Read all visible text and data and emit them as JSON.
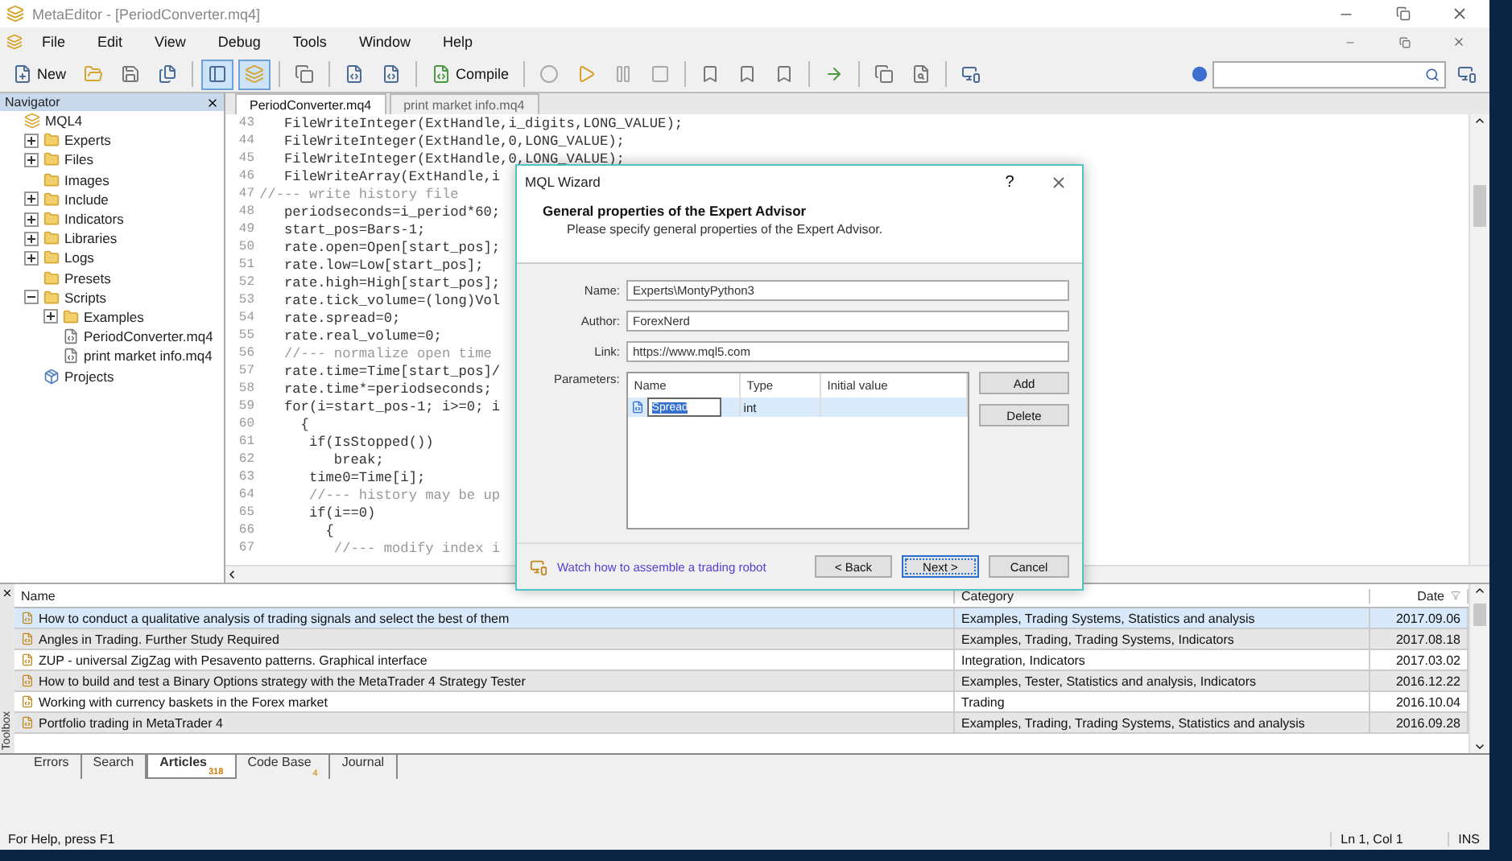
{
  "window": {
    "title": "MetaEditor - [PeriodConverter.mq4]"
  },
  "menu": [
    "File",
    "Edit",
    "View",
    "Debug",
    "Tools",
    "Window",
    "Help"
  ],
  "toolbar": {
    "new_label": "New",
    "compile_label": "Compile",
    "toggles": [
      {
        "selected": true
      },
      {
        "selected": true
      }
    ]
  },
  "navigator": {
    "title": "Navigator",
    "tree": [
      {
        "label": "MQL4",
        "kind": "root",
        "children": [
          {
            "label": "Experts",
            "kind": "folder",
            "expanded": false
          },
          {
            "label": "Files",
            "kind": "folder",
            "expanded": false
          },
          {
            "label": "Images",
            "kind": "folder"
          },
          {
            "label": "Include",
            "kind": "folder",
            "expanded": false
          },
          {
            "label": "Indicators",
            "kind": "folder",
            "expanded": false
          },
          {
            "label": "Libraries",
            "kind": "folder",
            "expanded": false
          },
          {
            "label": "Logs",
            "kind": "folder",
            "expanded": false
          },
          {
            "label": "Presets",
            "kind": "folder"
          },
          {
            "label": "Scripts",
            "kind": "folder",
            "expanded": true,
            "children": [
              {
                "label": "Examples",
                "kind": "folder",
                "expanded": false
              },
              {
                "label": "PeriodConverter.mq4",
                "kind": "file"
              },
              {
                "label": "print market info.mq4",
                "kind": "file"
              }
            ]
          },
          {
            "label": "Projects",
            "kind": "project"
          }
        ]
      }
    ]
  },
  "editor": {
    "tabs": [
      {
        "label": "PeriodConverter.mq4",
        "selected": true
      },
      {
        "label": "print market info.mq4",
        "selected": false
      }
    ],
    "lines": [
      {
        "number": "43",
        "text": "   FileWriteInteger(ExtHandle,i_digits,LONG_VALUE);",
        "kind": "code"
      },
      {
        "number": "44",
        "text": "   FileWriteInteger(ExtHandle,0,LONG_VALUE);",
        "kind": "code"
      },
      {
        "number": "45",
        "text": "   FileWriteInteger(ExtHandle,0,LONG_VALUE);",
        "kind": "code"
      },
      {
        "number": "46",
        "text": "   FileWriteArray(ExtHandle,i",
        "kind": "code"
      },
      {
        "number": "47",
        "text": "//--- write history file",
        "kind": "comment"
      },
      {
        "number": "48",
        "text": "   periodseconds=i_period*60;",
        "kind": "code"
      },
      {
        "number": "49",
        "text": "   start_pos=Bars-1;",
        "kind": "code"
      },
      {
        "number": "50",
        "text": "   rate.open=Open[start_pos];",
        "kind": "code"
      },
      {
        "number": "51",
        "text": "   rate.low=Low[start_pos];",
        "kind": "code"
      },
      {
        "number": "52",
        "text": "   rate.high=High[start_pos];",
        "kind": "code"
      },
      {
        "number": "53",
        "text": "   rate.tick_volume=(long)Vol",
        "kind": "code"
      },
      {
        "number": "54",
        "text": "   rate.spread=0;",
        "kind": "code"
      },
      {
        "number": "55",
        "text": "   rate.real_volume=0;",
        "kind": "code"
      },
      {
        "number": "56",
        "text": "   //--- normalize open time",
        "kind": "comment"
      },
      {
        "number": "57",
        "text": "   rate.time=Time[start_pos]/",
        "kind": "code"
      },
      {
        "number": "58",
        "text": "   rate.time*=periodseconds;",
        "kind": "code"
      },
      {
        "number": "59",
        "text": "   for(i=start_pos-1; i>=0; i",
        "kind": "code"
      },
      {
        "number": "60",
        "text": "     {",
        "kind": "code"
      },
      {
        "number": "61",
        "text": "      if(IsStopped())",
        "kind": "code"
      },
      {
        "number": "62",
        "text": "         break;",
        "kind": "code"
      },
      {
        "number": "63",
        "text": "      time0=Time[i];",
        "kind": "code"
      },
      {
        "number": "64",
        "text": "      //--- history may be up",
        "kind": "comment"
      },
      {
        "number": "65",
        "text": "      if(i==0)",
        "kind": "code"
      },
      {
        "number": "66",
        "text": "        {",
        "kind": "code"
      },
      {
        "number": "67",
        "text": "         //--- modify index i",
        "kind": "comment"
      }
    ]
  },
  "dialog": {
    "title": "MQL Wizard",
    "help": "?",
    "heading": "General properties of the Expert Advisor",
    "subheading": "Please specify general properties of the Expert Advisor.",
    "fields": [
      {
        "label": "Name:",
        "value": "Experts\\MontyPython3"
      },
      {
        "label": "Author:",
        "value": "ForexNerd"
      },
      {
        "label": "Link:",
        "value": "https://www.mql5.com"
      }
    ],
    "parameters": {
      "label": "Parameters:",
      "columns": [
        "Name",
        "Type",
        "Initial value"
      ],
      "rows": [
        {
          "name": "Spread",
          "type": "int",
          "selected": true
        }
      ],
      "buttons": [
        "Add",
        "Delete"
      ]
    },
    "link": "Watch how to assemble a trading robot",
    "buttons": [
      {
        "label": "< Back",
        "focused": false
      },
      {
        "label": "Next >",
        "focused": true
      },
      {
        "label": "Cancel",
        "focused": false
      }
    ]
  },
  "toolbox": {
    "label": "Toolbox",
    "columns": [
      "Name",
      "Category",
      "Date"
    ],
    "rows": [
      {
        "name": "How to conduct a qualitative analysis of trading signals and select the best of them",
        "category": "Examples, Trading Systems, Statistics and analysis",
        "date": "2017.09.06",
        "selected": true
      },
      {
        "name": "Angles in Trading. Further Study Required",
        "category": "Examples, Trading, Trading Systems, Indicators",
        "date": "2017.08.18",
        "selected": false
      },
      {
        "name": "ZUP - universal ZigZag with Pesavento patterns. Graphical interface",
        "category": "Integration, Indicators",
        "date": "2017.03.02",
        "selected": false
      },
      {
        "name": "How to build and test a Binary Options strategy with the MetaTrader 4 Strategy Tester",
        "category": "Examples, Tester, Statistics and analysis, Indicators",
        "date": "2016.12.22",
        "selected": false
      },
      {
        "name": "Working with currency baskets in the Forex market",
        "category": "Trading",
        "date": "2016.10.04",
        "selected": false
      },
      {
        "name": "Portfolio trading in MetaTrader 4",
        "category": "Examples, Trading, Trading Systems, Statistics and analysis",
        "date": "2016.09.28",
        "selected": false
      }
    ],
    "tabs": [
      {
        "label": "Errors",
        "selected": false
      },
      {
        "label": "Search",
        "selected": false
      },
      {
        "label": "Articles",
        "badge": "318",
        "selected": true
      },
      {
        "label": "Code Base",
        "badge": "4",
        "selected": false
      },
      {
        "label": "Journal",
        "selected": false
      }
    ]
  },
  "status_bar": {
    "message": "For Help, press F1",
    "position": "Ln 1, Col 1",
    "mode": "INS"
  }
}
